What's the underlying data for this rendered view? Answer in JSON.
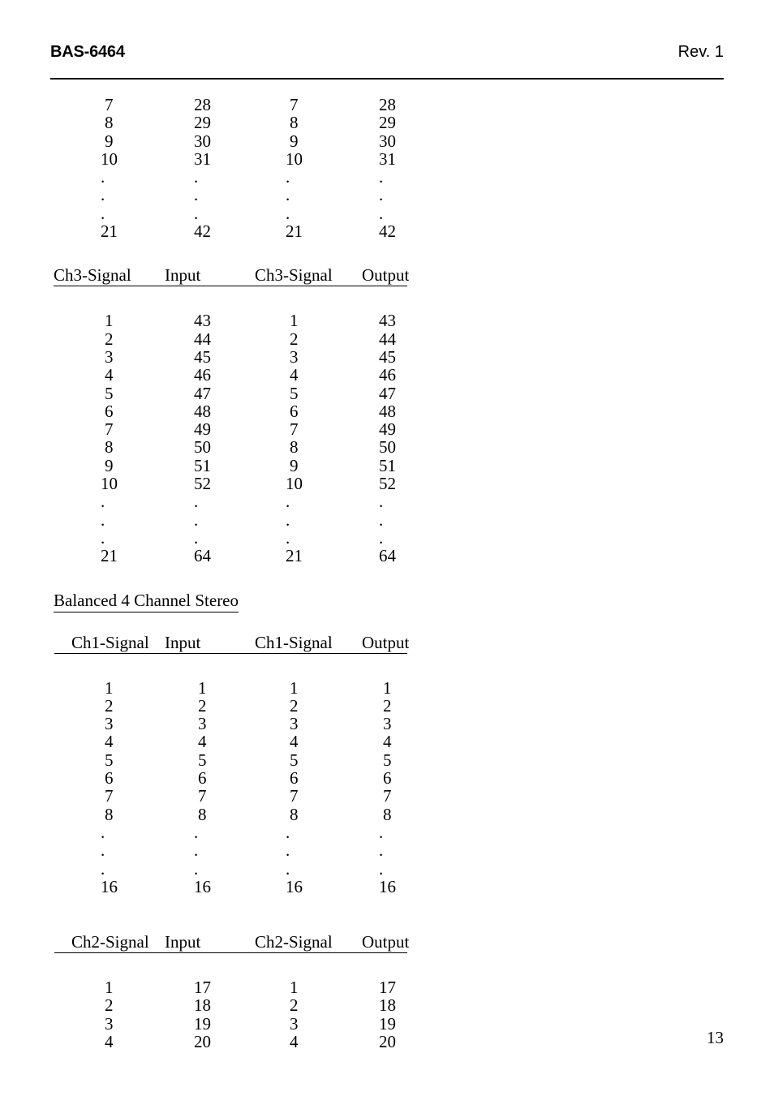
{
  "header": {
    "doc_id": "BAS-6464",
    "revision": "Rev. 1"
  },
  "footer": {
    "page_number": "13"
  },
  "sections": [
    {
      "id": "ch2-continued",
      "heading": null,
      "columns": [
        "",
        "",
        "",
        ""
      ],
      "rows": [
        [
          "7",
          "28",
          "7",
          "28"
        ],
        [
          "8",
          "29",
          "8",
          "29"
        ],
        [
          "9",
          "30",
          "9",
          "30"
        ],
        [
          "10",
          "31",
          "10",
          "31"
        ],
        [
          ".",
          ".",
          ".",
          "."
        ],
        [
          ".",
          ".",
          ".",
          "."
        ],
        [
          ".",
          ".",
          ".",
          "."
        ],
        [
          "21",
          "42",
          "21",
          "42"
        ]
      ]
    },
    {
      "id": "ch3-unbalanced",
      "heading": null,
      "columns": [
        "Ch3-Signal",
        "Input",
        "Ch3-Signal",
        "Output"
      ],
      "rows": [
        [
          "1",
          "43",
          "1",
          "43"
        ],
        [
          "2",
          "44",
          "2",
          "44"
        ],
        [
          "3",
          "45",
          "3",
          "45"
        ],
        [
          "4",
          "46",
          "4",
          "46"
        ],
        [
          "5",
          "47",
          "5",
          "47"
        ],
        [
          "6",
          "48",
          "6",
          "48"
        ],
        [
          "7",
          "49",
          "7",
          "49"
        ],
        [
          "8",
          "50",
          "8",
          "50"
        ],
        [
          "9",
          "51",
          "9",
          "51"
        ],
        [
          "10",
          "52",
          "10",
          "52"
        ],
        [
          ".",
          ".",
          ".",
          "."
        ],
        [
          ".",
          ".",
          ".",
          "."
        ],
        [
          ".",
          ".",
          ".",
          "."
        ],
        [
          "21",
          "64",
          "21",
          "64"
        ]
      ]
    },
    {
      "id": "balanced-4-channel-stereo-ch1",
      "heading": "Balanced 4 Channel Stereo",
      "columns": [
        "Ch1-Signal",
        "Input",
        "Ch1-Signal",
        "Output"
      ],
      "rows": [
        [
          "1",
          "1",
          "1",
          "1"
        ],
        [
          "2",
          "2",
          "2",
          "2"
        ],
        [
          "3",
          "3",
          "3",
          "3"
        ],
        [
          "4",
          "4",
          "4",
          "4"
        ],
        [
          "5",
          "5",
          "5",
          "5"
        ],
        [
          "6",
          "6",
          "6",
          "6"
        ],
        [
          "7",
          "7",
          "7",
          "7"
        ],
        [
          "8",
          "8",
          "8",
          "8"
        ],
        [
          ".",
          ".",
          ".",
          "."
        ],
        [
          ".",
          ".",
          ".",
          "."
        ],
        [
          ".",
          ".",
          ".",
          "."
        ],
        [
          "16",
          "16",
          "16",
          "16"
        ]
      ]
    },
    {
      "id": "balanced-4-channel-stereo-ch2",
      "heading": null,
      "columns": [
        "Ch2-Signal",
        "Input",
        "Ch2-Signal",
        "Output"
      ],
      "rows": [
        [
          "1",
          "17",
          "1",
          "17"
        ],
        [
          "2",
          "18",
          "2",
          "18"
        ],
        [
          "3",
          "19",
          "3",
          "19"
        ],
        [
          "4",
          "20",
          "4",
          "20"
        ]
      ]
    }
  ]
}
